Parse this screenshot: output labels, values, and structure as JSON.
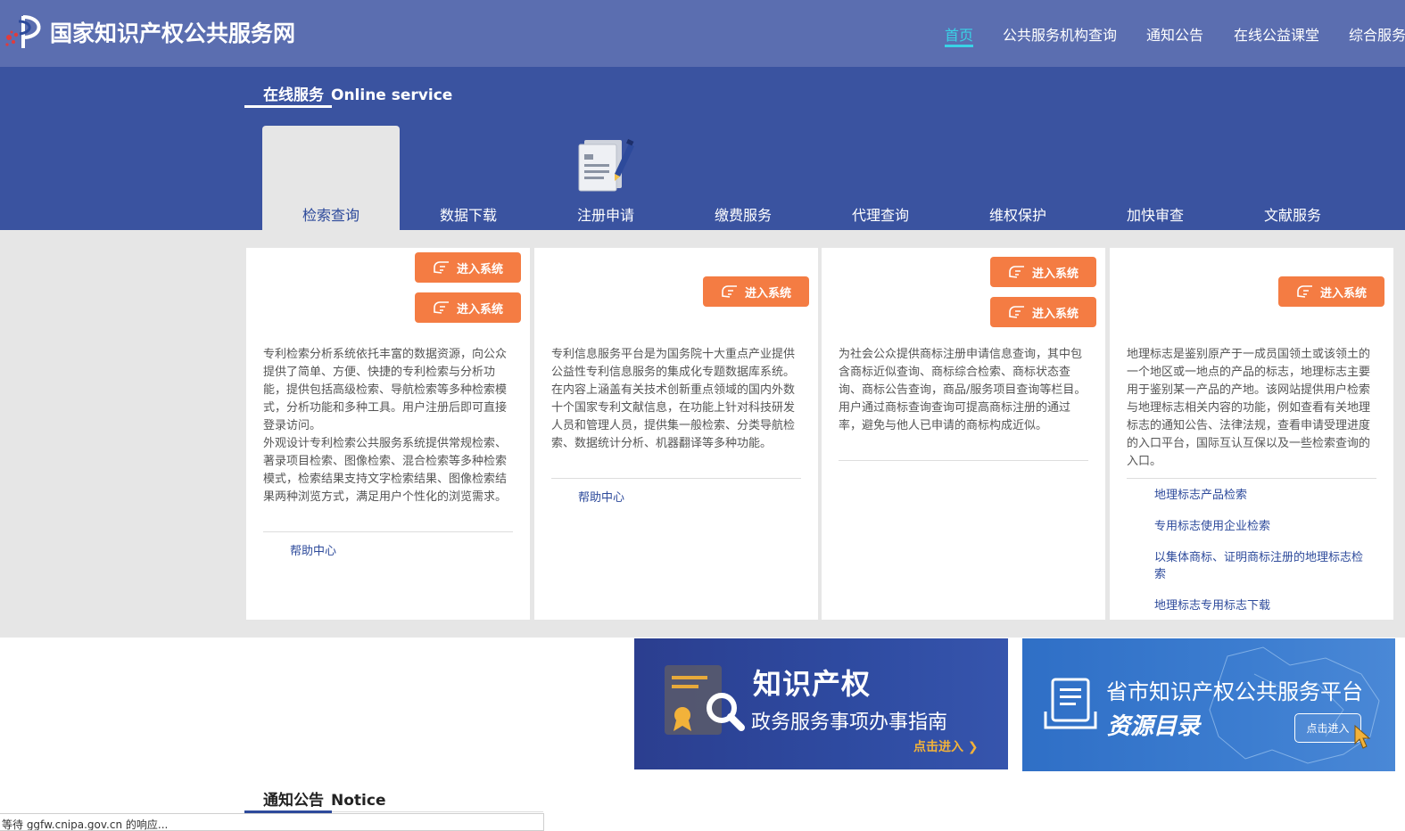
{
  "header": {
    "site_title": "国家知识产权公共服务网",
    "nav": [
      "首页",
      "公共服务机构查询",
      "通知公告",
      "在线公益课堂",
      "综合服务"
    ],
    "active_nav": "首页"
  },
  "online_service": {
    "title_cn": "在线服务",
    "title_en": "Online service",
    "tabs": [
      "检索查询",
      "数据下载",
      "注册申请",
      "缴费服务",
      "代理查询",
      "维权保护",
      "加快审查",
      "文献服务"
    ],
    "active_tab": "检索查询"
  },
  "cards": [
    {
      "buttons": [
        "进入系统",
        "进入系统"
      ],
      "description": "专利检索分析系统依托丰富的数据资源，向公众提供了简单、方便、快捷的专利检索与分析功能，提供包括高级检索、导航检索等多种检索模式，分析功能和多种工具。用户注册后即可直接登录访问。",
      "description2": "外观设计专利检索公共服务系统提供常规检索、著录项目检索、图像检索、混合检索等多种检索模式，检索结果支持文字检索结果、图像检索结果两种浏览方式，满足用户个性化的浏览需求。",
      "help": "帮助中心"
    },
    {
      "buttons": [
        "进入系统"
      ],
      "description": "专利信息服务平台是为国务院十大重点产业提供公益性专利信息服务的集成化专题数据库系统。在内容上涵盖有关技术创新重点领域的国内外数十个国家专利文献信息，在功能上针对科技研发人员和管理人员，提供集一般检索、分类导航检索、数据统计分析、机器翻译等多种功能。",
      "help": "帮助中心"
    },
    {
      "buttons": [
        "进入系统",
        "进入系统"
      ],
      "description": "为社会公众提供商标注册申请信息查询，其中包含商标近似查询、商标综合检索、商标状态查询、商标公告查询，商品/服务项目查询等栏目。用户通过商标查询查询可提高商标注册的通过率，避免与他人已申请的商标构成近似。"
    },
    {
      "buttons": [
        "进入系统"
      ],
      "description": "地理标志是鉴别原产于一成员国领土或该领土的一个地区或一地点的产品的标志，地理标志主要用于鉴别某一产品的产地。该网站提供用户检索与地理标志相关内容的功能，例如查看有关地理标志的通知公告、法律法规，查看申请受理进度的入口平台，国际互认互保以及一些检索查询的入口。",
      "links": [
        "地理标志产品检索",
        "专用标志使用企业检索",
        "以集体商标、证明商标注册的地理标志检索",
        "地理标志专用标志下载"
      ]
    }
  ],
  "banners": {
    "guide": {
      "title": "知识产权",
      "subtitle": "政务服务事项办事指南",
      "enter": "点击进入"
    },
    "catalog": {
      "title": "省市知识产权公共服务平台",
      "subtitle": "资源目录",
      "button": "点击进入"
    }
  },
  "notice": {
    "title_cn": "通知公告",
    "title_en": "Notice"
  },
  "status_bar": "等待 ggfw.cnipa.gov.cn 的响应..."
}
